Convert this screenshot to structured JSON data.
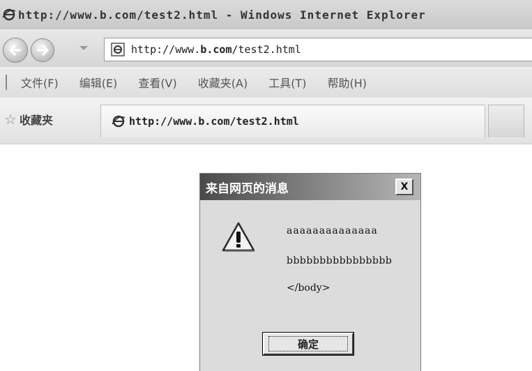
{
  "window": {
    "title": "http://www.b.com/test2.html - Windows Internet Explorer"
  },
  "address_bar": {
    "url_prefix": "http://www.",
    "url_domain": "b.com",
    "url_path": "/test2.html"
  },
  "menu": {
    "items": [
      {
        "label": "文件(F)"
      },
      {
        "label": "编辑(E)"
      },
      {
        "label": "查看(V)"
      },
      {
        "label": "收藏夹(A)"
      },
      {
        "label": "工具(T)"
      },
      {
        "label": "帮助(H)"
      }
    ]
  },
  "favorites": {
    "label": "收藏夹",
    "star_icon": "star-icon"
  },
  "tab": {
    "title": "http://www.b.com/test2.html"
  },
  "dialog": {
    "title": "来自网页的消息",
    "close_label": "X",
    "icon": "warning-icon",
    "lines": [
      "aaaaaaaaaaaaaa",
      "bbbbbbbbbbbbbbbb",
      "</body>"
    ],
    "ok_label": "确定"
  },
  "colors": {
    "titlebar": "#c8c8c8",
    "dialog_bg": "#dcdcdc"
  }
}
